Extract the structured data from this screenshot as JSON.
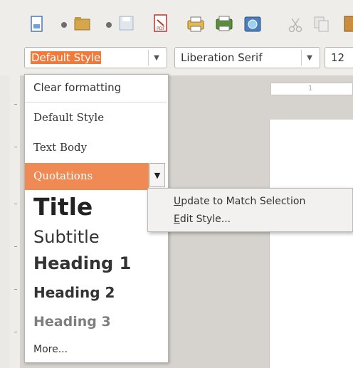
{
  "style_combo": {
    "value": "Default Style"
  },
  "font_combo": {
    "value": "Liberation Serif"
  },
  "size_combo": {
    "value": "12"
  },
  "ruler": {
    "marks": "1"
  },
  "style_list": {
    "items": [
      {
        "key": "clear",
        "label": "Clear formatting"
      },
      {
        "key": "default",
        "label": "Default Style"
      },
      {
        "key": "textbody",
        "label": "Text Body"
      },
      {
        "key": "quote",
        "label": "Quotations"
      },
      {
        "key": "title",
        "label": "Title"
      },
      {
        "key": "subtitle",
        "label": "Subtitle"
      },
      {
        "key": "h1",
        "label": "Heading 1"
      },
      {
        "key": "h2",
        "label": "Heading 2"
      },
      {
        "key": "h3",
        "label": "Heading 3"
      },
      {
        "key": "more",
        "label": "More..."
      }
    ]
  },
  "context_menu": {
    "update_mnemonic": "U",
    "update_rest": "pdate to Match Selection",
    "edit_mnemonic": "E",
    "edit_rest": "dit Style..."
  },
  "colors": {
    "highlight": "#f08a55",
    "selection": "#f07a3a"
  },
  "icons": [
    "new-document-icon",
    "open-folder-icon",
    "save-icon",
    "export-pdf-icon",
    "print-icon",
    "print-preview-icon",
    "spellcheck-icon",
    "cut-icon",
    "copy-icon"
  ]
}
